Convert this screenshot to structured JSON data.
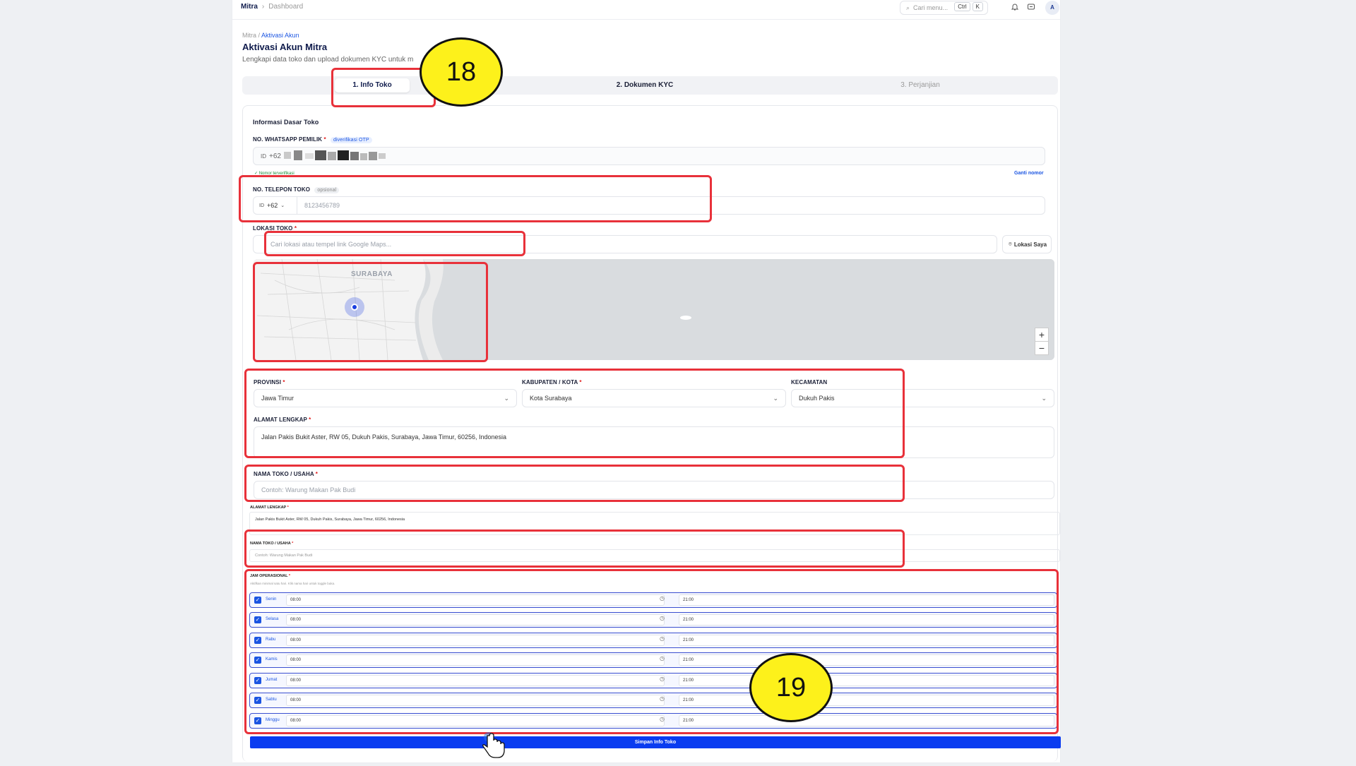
{
  "topbar": {
    "brand": "Mitra",
    "separator": "›",
    "page": "Dashboard",
    "search_placeholder": "Cari menu...",
    "kbd_ctrl": "Ctrl",
    "kbd_k": "K",
    "avatar": "A"
  },
  "breadcrumb": {
    "parent": "Mitra",
    "sep": "/",
    "current": "Aktivasi Akun"
  },
  "title": "Aktivasi Akun Mitra",
  "subtitle": "Lengkapi data toko dan upload dokumen KYC untuk m",
  "tabs": [
    {
      "label": "1. Info Toko"
    },
    {
      "label": "2. Dokumen KYC"
    },
    {
      "label": "3. Perjanjian"
    }
  ],
  "section_title": "Informasi Dasar Toko",
  "whatsapp": {
    "label": "NO. WHATSAPP PEMILIK",
    "badge": "diverifikasi OTP",
    "country": "ID",
    "prefix": "+62",
    "verified_note": "✓ Nomor terverifikasi",
    "change_link": "Ganti nomor"
  },
  "phone": {
    "label": "NO. TELEPON TOKO",
    "badge": "opsional",
    "country": "ID",
    "code": "+62",
    "placeholder": "8123456789"
  },
  "location": {
    "label": "LOKASI TOKO",
    "placeholder": "Cari lokasi atau tempel link Google Maps...",
    "my_location": "Lokasi Saya"
  },
  "map": {
    "city_label": "SURABAYA",
    "zoom_in": "+",
    "zoom_out": "−"
  },
  "province": {
    "label": "PROVINSI",
    "value": "Jawa Timur"
  },
  "city": {
    "label": "KABUPATEN / KOTA",
    "value": "Kota Surabaya"
  },
  "district": {
    "label": "KECAMATAN",
    "value": "Dukuh Pakis"
  },
  "address": {
    "label": "ALAMAT LENGKAP",
    "value": "Jalan Pakis Bukit Aster, RW 05, Dukuh Pakis, Surabaya, Jawa Timur, 60256, Indonesia"
  },
  "store_name": {
    "label": "NAMA TOKO / USAHA",
    "placeholder": "Contoh: Warung Makan Pak Budi"
  },
  "hours": {
    "label": "JAM OPERASIONAL",
    "hint": "Aktifkan minimal satu hari. Klik nama hari untuk toggle buka.",
    "days": [
      {
        "name": "Senin",
        "open": "08:00",
        "close": "21:00"
      },
      {
        "name": "Selasa",
        "open": "08:00",
        "close": "21:00"
      },
      {
        "name": "Rabu",
        "open": "08:00",
        "close": "21:00"
      },
      {
        "name": "Kamis",
        "open": "08:00",
        "close": "21:00"
      },
      {
        "name": "Jumat",
        "open": "08:00",
        "close": "21:00"
      },
      {
        "name": "Sabtu",
        "open": "08:00",
        "close": "21:00"
      },
      {
        "name": "Minggu",
        "open": "08:00",
        "close": "21:00"
      }
    ]
  },
  "save_label": "Simpan Info Toko",
  "annotations": {
    "step18": "18",
    "step19": "19"
  },
  "colors": {
    "accent": "#1b55e2",
    "highlight": "#e8313a",
    "bubble": "#fdf11b",
    "primary_button": "#0a3cf0"
  }
}
